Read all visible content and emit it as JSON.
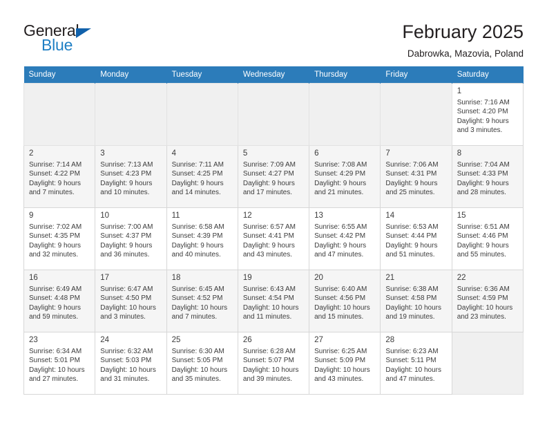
{
  "brand": {
    "name_part1": "General",
    "name_part2": "Blue",
    "logo_icon": "triangle-flag-icon",
    "accent_color": "#1f7fc4",
    "header_color": "#2c7cba"
  },
  "header": {
    "title": "February 2025",
    "subtitle": "Dabrowka, Mazovia, Poland"
  },
  "weekday_headers": [
    "Sunday",
    "Monday",
    "Tuesday",
    "Wednesday",
    "Thursday",
    "Friday",
    "Saturday"
  ],
  "labels": {
    "sunrise": "Sunrise:",
    "sunset": "Sunset:",
    "daylight": "Daylight:"
  },
  "weeks": [
    [
      {
        "empty": true
      },
      {
        "empty": true
      },
      {
        "empty": true
      },
      {
        "empty": true
      },
      {
        "empty": true
      },
      {
        "empty": true
      },
      {
        "day": "1",
        "l1": "Sunrise: 7:16 AM",
        "l2": "Sunset: 4:20 PM",
        "l3": "Daylight: 9 hours",
        "l4": "and 3 minutes."
      }
    ],
    [
      {
        "day": "2",
        "l1": "Sunrise: 7:14 AM",
        "l2": "Sunset: 4:22 PM",
        "l3": "Daylight: 9 hours",
        "l4": "and 7 minutes."
      },
      {
        "day": "3",
        "l1": "Sunrise: 7:13 AM",
        "l2": "Sunset: 4:23 PM",
        "l3": "Daylight: 9 hours",
        "l4": "and 10 minutes."
      },
      {
        "day": "4",
        "l1": "Sunrise: 7:11 AM",
        "l2": "Sunset: 4:25 PM",
        "l3": "Daylight: 9 hours",
        "l4": "and 14 minutes."
      },
      {
        "day": "5",
        "l1": "Sunrise: 7:09 AM",
        "l2": "Sunset: 4:27 PM",
        "l3": "Daylight: 9 hours",
        "l4": "and 17 minutes."
      },
      {
        "day": "6",
        "l1": "Sunrise: 7:08 AM",
        "l2": "Sunset: 4:29 PM",
        "l3": "Daylight: 9 hours",
        "l4": "and 21 minutes."
      },
      {
        "day": "7",
        "l1": "Sunrise: 7:06 AM",
        "l2": "Sunset: 4:31 PM",
        "l3": "Daylight: 9 hours",
        "l4": "and 25 minutes."
      },
      {
        "day": "8",
        "l1": "Sunrise: 7:04 AM",
        "l2": "Sunset: 4:33 PM",
        "l3": "Daylight: 9 hours",
        "l4": "and 28 minutes."
      }
    ],
    [
      {
        "day": "9",
        "l1": "Sunrise: 7:02 AM",
        "l2": "Sunset: 4:35 PM",
        "l3": "Daylight: 9 hours",
        "l4": "and 32 minutes."
      },
      {
        "day": "10",
        "l1": "Sunrise: 7:00 AM",
        "l2": "Sunset: 4:37 PM",
        "l3": "Daylight: 9 hours",
        "l4": "and 36 minutes."
      },
      {
        "day": "11",
        "l1": "Sunrise: 6:58 AM",
        "l2": "Sunset: 4:39 PM",
        "l3": "Daylight: 9 hours",
        "l4": "and 40 minutes."
      },
      {
        "day": "12",
        "l1": "Sunrise: 6:57 AM",
        "l2": "Sunset: 4:41 PM",
        "l3": "Daylight: 9 hours",
        "l4": "and 43 minutes."
      },
      {
        "day": "13",
        "l1": "Sunrise: 6:55 AM",
        "l2": "Sunset: 4:42 PM",
        "l3": "Daylight: 9 hours",
        "l4": "and 47 minutes."
      },
      {
        "day": "14",
        "l1": "Sunrise: 6:53 AM",
        "l2": "Sunset: 4:44 PM",
        "l3": "Daylight: 9 hours",
        "l4": "and 51 minutes."
      },
      {
        "day": "15",
        "l1": "Sunrise: 6:51 AM",
        "l2": "Sunset: 4:46 PM",
        "l3": "Daylight: 9 hours",
        "l4": "and 55 minutes."
      }
    ],
    [
      {
        "day": "16",
        "l1": "Sunrise: 6:49 AM",
        "l2": "Sunset: 4:48 PM",
        "l3": "Daylight: 9 hours",
        "l4": "and 59 minutes."
      },
      {
        "day": "17",
        "l1": "Sunrise: 6:47 AM",
        "l2": "Sunset: 4:50 PM",
        "l3": "Daylight: 10 hours",
        "l4": "and 3 minutes."
      },
      {
        "day": "18",
        "l1": "Sunrise: 6:45 AM",
        "l2": "Sunset: 4:52 PM",
        "l3": "Daylight: 10 hours",
        "l4": "and 7 minutes."
      },
      {
        "day": "19",
        "l1": "Sunrise: 6:43 AM",
        "l2": "Sunset: 4:54 PM",
        "l3": "Daylight: 10 hours",
        "l4": "and 11 minutes."
      },
      {
        "day": "20",
        "l1": "Sunrise: 6:40 AM",
        "l2": "Sunset: 4:56 PM",
        "l3": "Daylight: 10 hours",
        "l4": "and 15 minutes."
      },
      {
        "day": "21",
        "l1": "Sunrise: 6:38 AM",
        "l2": "Sunset: 4:58 PM",
        "l3": "Daylight: 10 hours",
        "l4": "and 19 minutes."
      },
      {
        "day": "22",
        "l1": "Sunrise: 6:36 AM",
        "l2": "Sunset: 4:59 PM",
        "l3": "Daylight: 10 hours",
        "l4": "and 23 minutes."
      }
    ],
    [
      {
        "day": "23",
        "l1": "Sunrise: 6:34 AM",
        "l2": "Sunset: 5:01 PM",
        "l3": "Daylight: 10 hours",
        "l4": "and 27 minutes."
      },
      {
        "day": "24",
        "l1": "Sunrise: 6:32 AM",
        "l2": "Sunset: 5:03 PM",
        "l3": "Daylight: 10 hours",
        "l4": "and 31 minutes."
      },
      {
        "day": "25",
        "l1": "Sunrise: 6:30 AM",
        "l2": "Sunset: 5:05 PM",
        "l3": "Daylight: 10 hours",
        "l4": "and 35 minutes."
      },
      {
        "day": "26",
        "l1": "Sunrise: 6:28 AM",
        "l2": "Sunset: 5:07 PM",
        "l3": "Daylight: 10 hours",
        "l4": "and 39 minutes."
      },
      {
        "day": "27",
        "l1": "Sunrise: 6:25 AM",
        "l2": "Sunset: 5:09 PM",
        "l3": "Daylight: 10 hours",
        "l4": "and 43 minutes."
      },
      {
        "day": "28",
        "l1": "Sunrise: 6:23 AM",
        "l2": "Sunset: 5:11 PM",
        "l3": "Daylight: 10 hours",
        "l4": "and 47 minutes."
      },
      {
        "empty": true
      }
    ]
  ]
}
